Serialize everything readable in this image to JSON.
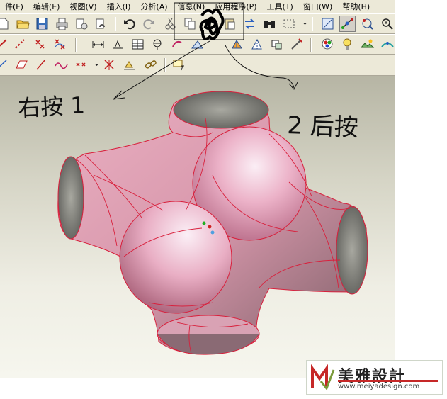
{
  "menu": [
    {
      "label": "件(F)"
    },
    {
      "label": "编辑(E)"
    },
    {
      "label": "视图(V)"
    },
    {
      "label": "插入(I)"
    },
    {
      "label": "分析(A)"
    },
    {
      "label": "信息(N)"
    },
    {
      "label": "应用程序(P)"
    },
    {
      "label": "工具(T)"
    },
    {
      "label": "窗口(W)"
    },
    {
      "label": "帮助(H)"
    }
  ],
  "annotations": {
    "left_note": "右按 1",
    "right_note": "2 后按"
  },
  "watermark": {
    "title": "美雅設計",
    "url": "www.meiyadesign.com"
  },
  "colors": {
    "model_fill": "#e8a0b4",
    "edge": "#d8203c",
    "ui_face": "#ece9d8"
  }
}
